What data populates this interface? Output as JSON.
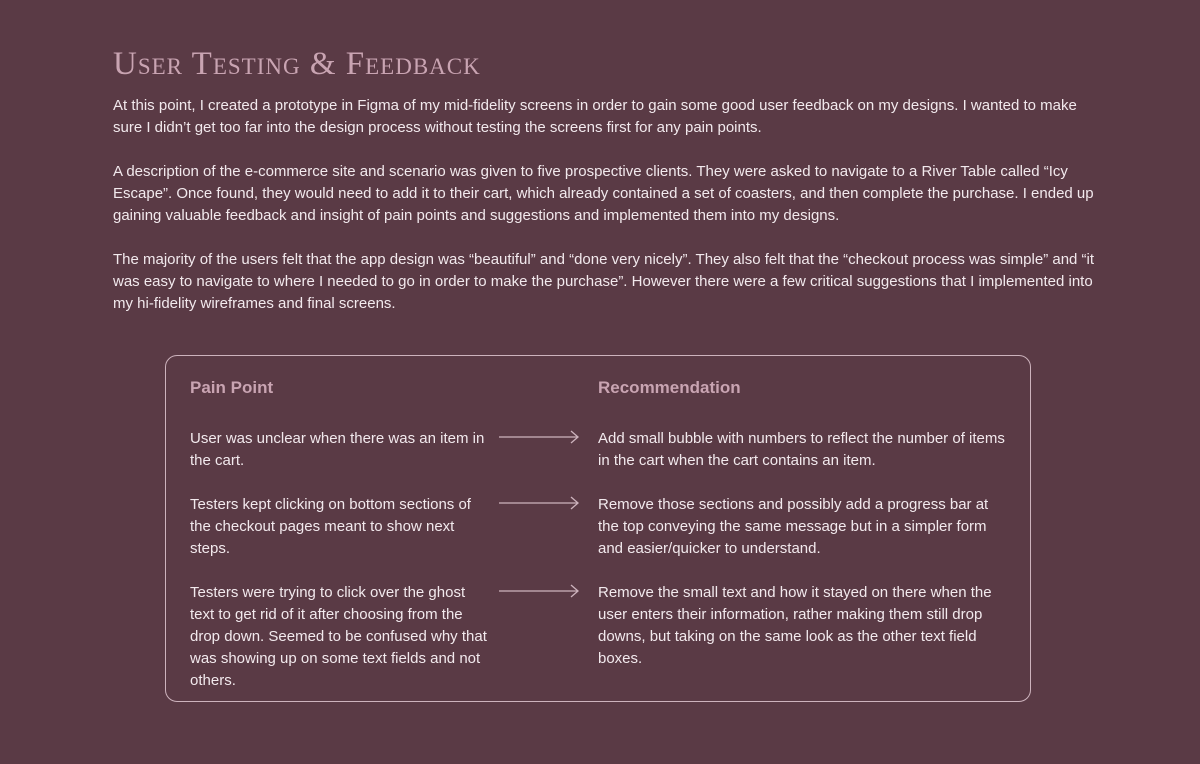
{
  "heading": "User Testing & Feedback",
  "paragraphs": [
    "At this point, I created a prototype in Figma of my mid-fidelity screens in order to gain some good user feedback on my designs. I wanted to make sure I didn’t get too far into the design process without testing the screens first for any pain points.",
    "A description of the e-commerce site and scenario was given to five prospective clients. They were asked to navigate to a River Table called “Icy Escape”. Once found, they would need to add it to their cart, which already contained a set of coasters, and then complete the purchase. I ended up gaining valuable feedback and insight of pain points and suggestions and implemented them into my designs.",
    "The majority of the users felt that the app design was “beautiful” and “done very nicely”. They also felt that the “checkout process was simple” and “it was easy to navigate to where I needed to go in order to make the purchase”. However there were a few critical suggestions that I implemented into my hi-fidelity wireframes and final screens."
  ],
  "table": {
    "pain_header": "Pain Point",
    "rec_header": "Recommendation",
    "rows": [
      {
        "pain": "User was unclear when there was an item in the cart.",
        "recommendation": "Add small bubble with numbers to reflect the number of items in the cart when the cart contains an item."
      },
      {
        "pain": "Testers kept clicking on bottom sections of the checkout pages meant to show next steps.",
        "recommendation": "Remove those sections and possibly add a progress bar at the top conveying the same message but in a simpler form and easier/quicker to understand."
      },
      {
        "pain": "Testers were trying to click over the ghost text to get rid of it after choosing from the drop down. Seemed to be confused why that was showing up on some text fields and not others.",
        "recommendation": "Remove the small text and how it stayed on there when the user enters their information, rather making them still drop downs, but taking on the same look as the other text field boxes."
      }
    ]
  },
  "colors": {
    "background": "#5a3a45",
    "accent": "#c9a4b2",
    "text": "#f2e9ed"
  }
}
